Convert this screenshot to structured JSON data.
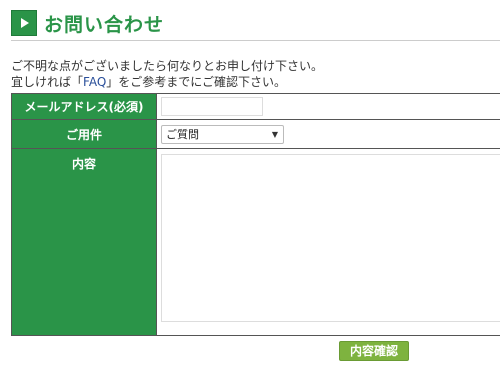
{
  "header": {
    "title": "お問い合わせ",
    "icon": "play-triangle-icon",
    "color": "#2a9448"
  },
  "intro": {
    "line1": "ご不明な点がございましたら何なりとお申し付け下さい。",
    "line2_before": "宜しければ「",
    "faq_link": "FAQ",
    "line2_after": "」をご参考までにご確認下さい。"
  },
  "form": {
    "email_label": "メールアドレス(必須)",
    "email_value": "",
    "type_label": "ご用件",
    "type_selected": "ご質問",
    "body_label": "内容",
    "body_value": ""
  },
  "submit_label": "内容確認",
  "colors": {
    "label_bg": "#2a9448",
    "button_bg": "#7eb33f",
    "link": "#2a4f9a"
  }
}
